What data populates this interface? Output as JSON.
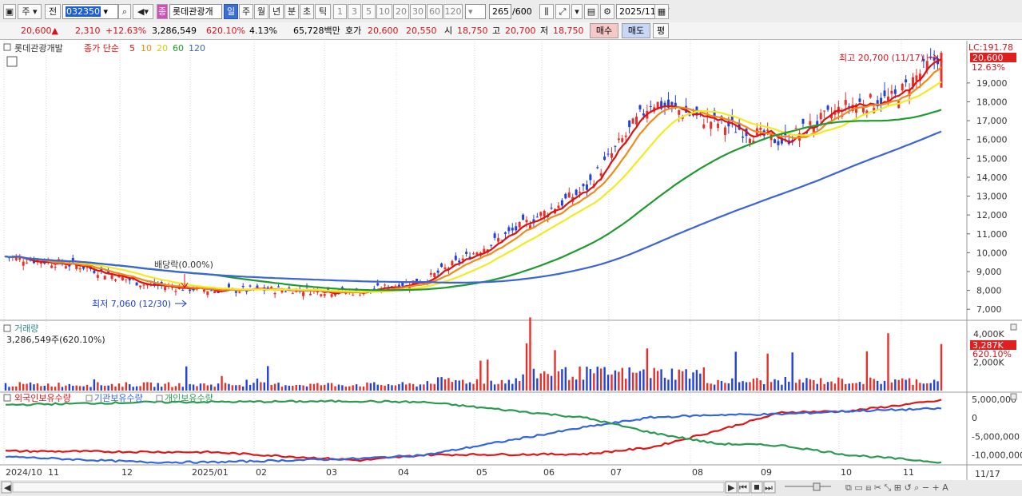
{
  "toolbar": {
    "market": "주",
    "prev": "전",
    "code": "032350",
    "name": "롯데관광개",
    "badge": "종",
    "periods": [
      "일",
      "주",
      "월",
      "년",
      "분",
      "초",
      "틱"
    ],
    "minutes": [
      "1",
      "3",
      "5",
      "10",
      "20",
      "30",
      "60",
      "120"
    ],
    "count": "265",
    "count_total": "/600",
    "date": "2025/11/17"
  },
  "quote": {
    "price": "20,600▲",
    "change": "2,310",
    "rate": "+12.63%",
    "volume": "3,286,549",
    "vol_ratio": "620.10%",
    "turnover": "4.13%",
    "amount": "65,728백만",
    "ask_label": "호가",
    "ask": "20,600",
    "bid": "20,550",
    "open_label": "시",
    "open": "18,750",
    "high_label": "고",
    "high": "20,700",
    "low_label": "저",
    "low": "18,750",
    "buy": "매수",
    "sell": "매도",
    "eval": "평"
  },
  "price_panel": {
    "name": "롯데관광개발",
    "ma_label": "종가 단순",
    "ma_periods": [
      "5",
      "10",
      "20",
      "60",
      "120"
    ],
    "lc": "LC:191.78",
    "last_price": "20,600",
    "last_rate": "12.63%",
    "high_note": "최고 20,700 (11/17)",
    "low_note": "최저 7,060 (12/30)",
    "dividend_note": "배당락(0.00%)"
  },
  "volume_panel": {
    "title": "거래량",
    "summary": "3,286,549주(620.10%)",
    "last_volume": "3,287K",
    "last_ratio": "620.10%"
  },
  "holdings_panel": {
    "labels": [
      "외국인보유수량",
      "기관보유수량",
      "개인보유수량"
    ]
  },
  "x_axis": {
    "labels": [
      "2024/10",
      "11",
      "12",
      "2025/01",
      "02",
      "03",
      "04",
      "05",
      "06",
      "07",
      "08",
      "09",
      "10",
      "11"
    ],
    "end_label": "11/17"
  },
  "colors": {
    "up": "#e8302a",
    "down": "#2441d8",
    "ma5": "#e01010",
    "ma10": "#f08a1a",
    "ma20": "#f2ea22",
    "ma60": "#1f9a2e",
    "ma120": "#3a64d8",
    "foreign": "#e01515",
    "institution": "#3465e0",
    "individual": "#2a9a50"
  },
  "chart_data": [
    {
      "type": "candlestick",
      "name": "price",
      "x": [
        "2024-10-01",
        "2024-11-01",
        "2024-12-01",
        "2025-01-01",
        "2025-02-01",
        "2025-03-01",
        "2025-04-01",
        "2025-05-01",
        "2025-06-01",
        "2025-07-01",
        "2025-08-01",
        "2025-09-01",
        "2025-10-01",
        "2025-11-01",
        "2025-11-17"
      ],
      "close": [
        9800,
        9300,
        8300,
        8000,
        8050,
        7900,
        8600,
        10800,
        13400,
        18000,
        16900,
        15900,
        17800,
        18200,
        20600
      ],
      "ylim": [
        6500,
        20900
      ],
      "yticks": [
        7000,
        8000,
        9000,
        10000,
        11000,
        12000,
        13000,
        14000,
        15000,
        16000,
        17000,
        18000,
        19000
      ],
      "high": 20700,
      "low": 7060,
      "ma": {
        "periods": [
          5,
          10,
          20,
          60,
          120
        ]
      }
    },
    {
      "type": "bar",
      "name": "volume",
      "ylim": [
        0,
        4400000
      ],
      "yticks": [
        2000000,
        4000000
      ],
      "ytick_labels": [
        "2,000K",
        "4,000K"
      ],
      "last": 3286549
    },
    {
      "type": "line",
      "name": "holdings",
      "ylim": [
        -12500000,
        6500000
      ],
      "yticks": [
        5000000,
        0,
        -5000000,
        -10000000
      ],
      "ytick_labels": [
        "5,000,000",
        "0",
        "-5,000,000",
        "-10,000,000"
      ],
      "series": [
        {
          "name": "외국인보유수량",
          "x": [
            "2024-10",
            "2024-12",
            "2025-01",
            "2025-03",
            "2025-04",
            "2025-06",
            "2025-07",
            "2025-08",
            "2025-09",
            "2025-10",
            "2025-11"
          ],
          "values": [
            -9000000,
            -9200000,
            -9300000,
            -11500000,
            -10000000,
            -9800000,
            -8000000,
            -3500000,
            1500000,
            1800000,
            4700000
          ]
        },
        {
          "name": "기관보유수량",
          "x": [
            "2024-10",
            "2024-12",
            "2025-01",
            "2025-03",
            "2025-04",
            "2025-06",
            "2025-07",
            "2025-08",
            "2025-09",
            "2025-10",
            "2025-11"
          ],
          "values": [
            -10500000,
            -12000000,
            -12000000,
            -11000000,
            -10000000,
            -2500000,
            100000,
            800000,
            1000000,
            1800000,
            2500000
          ]
        },
        {
          "name": "개인보유수량",
          "x": [
            "2024-10",
            "2024-12",
            "2025-01",
            "2025-03",
            "2025-04",
            "2025-06",
            "2025-07",
            "2025-08",
            "2025-09",
            "2025-10",
            "2025-11"
          ],
          "values": [
            3500000,
            4200000,
            4300000,
            4500000,
            4200000,
            0,
            -4000000,
            -7000000,
            -7500000,
            -10000000,
            -12000000
          ]
        }
      ]
    }
  ]
}
